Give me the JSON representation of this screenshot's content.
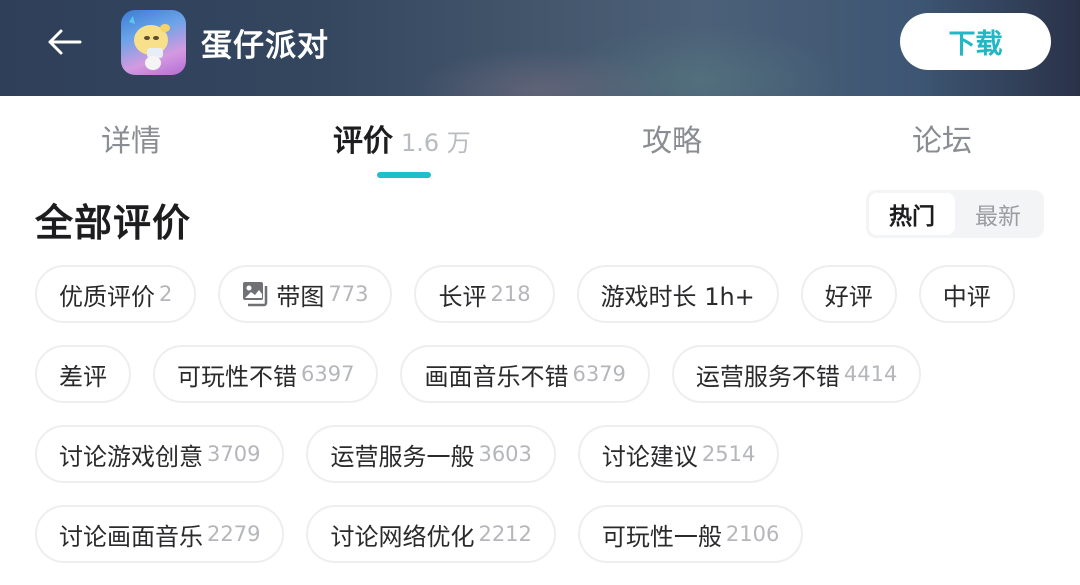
{
  "header": {
    "app_name": "蛋仔派对",
    "download_label": "下载",
    "back_icon": "arrow-left-icon",
    "accent_color": "#1fb8c4"
  },
  "tabs": [
    {
      "label": "详情",
      "count": "",
      "active": false
    },
    {
      "label": "评价",
      "count": "1.6 万",
      "active": true
    },
    {
      "label": "攻略",
      "count": "",
      "active": false
    },
    {
      "label": "论坛",
      "count": "",
      "active": false
    }
  ],
  "reviews": {
    "title": "全部评价",
    "sort_options": [
      {
        "label": "热门",
        "active": true
      },
      {
        "label": "最新",
        "active": false
      }
    ]
  },
  "filter_rows": [
    [
      {
        "label": "优质评价",
        "count": "2"
      },
      {
        "label": "带图",
        "count": "773",
        "icon": "image-icon"
      },
      {
        "label": "长评",
        "count": "218"
      },
      {
        "label": "游戏时长 1h+",
        "count": ""
      },
      {
        "label": "好评",
        "count": ""
      },
      {
        "label": "中评",
        "count": ""
      }
    ],
    [
      {
        "label": "差评",
        "count": ""
      },
      {
        "label": "可玩性不错",
        "count": "6397"
      },
      {
        "label": "画面音乐不错",
        "count": "6379"
      },
      {
        "label": "运营服务不错",
        "count": "4414"
      }
    ],
    [
      {
        "label": "讨论游戏创意",
        "count": "3709"
      },
      {
        "label": "运营服务一般",
        "count": "3603"
      },
      {
        "label": "讨论建议",
        "count": "2514"
      }
    ],
    [
      {
        "label": "讨论画面音乐",
        "count": "2279"
      },
      {
        "label": "讨论网络优化",
        "count": "2212"
      },
      {
        "label": "可玩性一般",
        "count": "2106"
      }
    ]
  ]
}
